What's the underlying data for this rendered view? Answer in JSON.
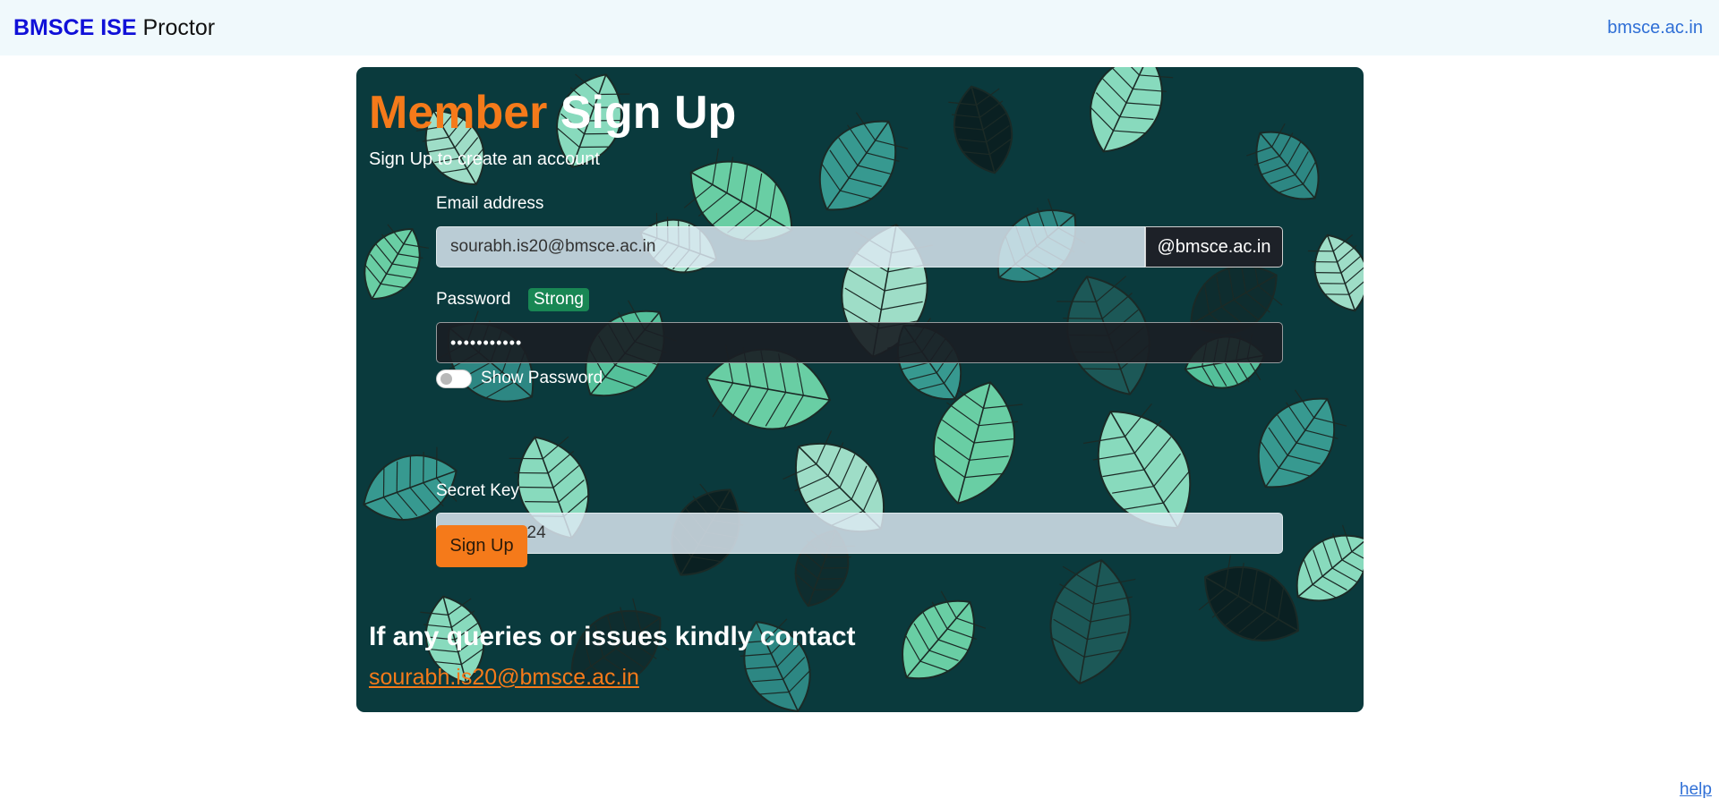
{
  "navbar": {
    "brand_strong": "BMSCE ISE",
    "brand_rest": "Proctor",
    "right_link": "bmsce.ac.in"
  },
  "card": {
    "title_accent": "Member",
    "title_rest": "Sign Up",
    "subtitle": "Sign Up to create an account"
  },
  "form": {
    "email_label": "Email address",
    "email_value": "sourabh.is20@bmsce.ac.in",
    "email_addon": "@bmsce.ac.in",
    "password_label": "Password",
    "password_strength": "Strong",
    "password_masked": "•••••••••••",
    "show_password_label": "Show Password",
    "show_password_checked": false,
    "secret_key_label": "Secret Key",
    "secret_key_value": "s20BMSis24",
    "submit_label": "Sign Up"
  },
  "contact": {
    "heading": "If any queries or issues kindly contact",
    "email": "sourabh.is20@bmsce.ac.in"
  },
  "footer": {
    "help_link": "help"
  },
  "colors": {
    "accent": "#f57a1a",
    "brand": "#1010d8",
    "link": "#2f6fd6",
    "badge_strong": "#198754",
    "card_bg": "#0a3a3d"
  }
}
